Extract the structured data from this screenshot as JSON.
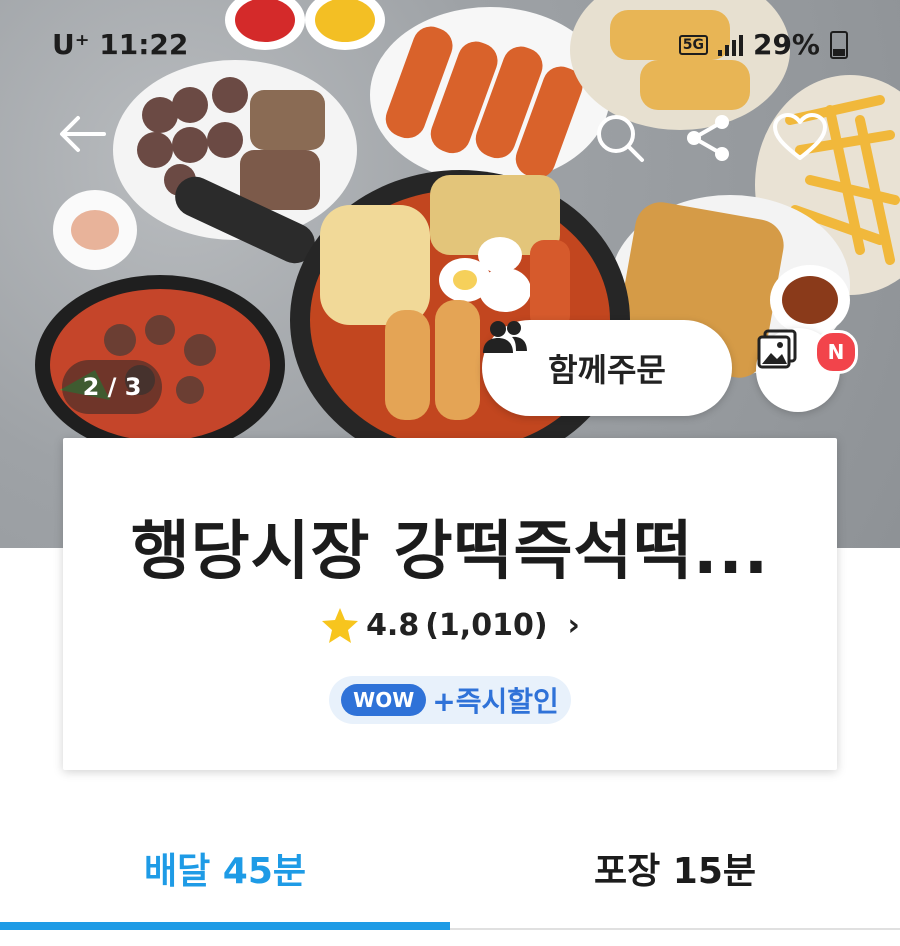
{
  "status_bar": {
    "carrier": "U⁺ 11:22",
    "network": "5G",
    "battery": "29%"
  },
  "hero": {
    "image_counter": "2 / 3",
    "group_order_label": "함께주문",
    "new_badge": "N"
  },
  "store": {
    "name": "행당시장 강떡즉석떡...",
    "rating": "4.8",
    "review_count": "(1,010)",
    "promo_badge": "WOW",
    "promo_text": "+즉시할인"
  },
  "tabs": [
    {
      "label": "배달 45분",
      "active": true
    },
    {
      "label": "포장 15분",
      "active": false
    }
  ],
  "colors": {
    "accent": "#1e9be6",
    "wow_blue": "#2f72d8",
    "badge_red": "#f2444b",
    "star": "#f7c51e"
  }
}
